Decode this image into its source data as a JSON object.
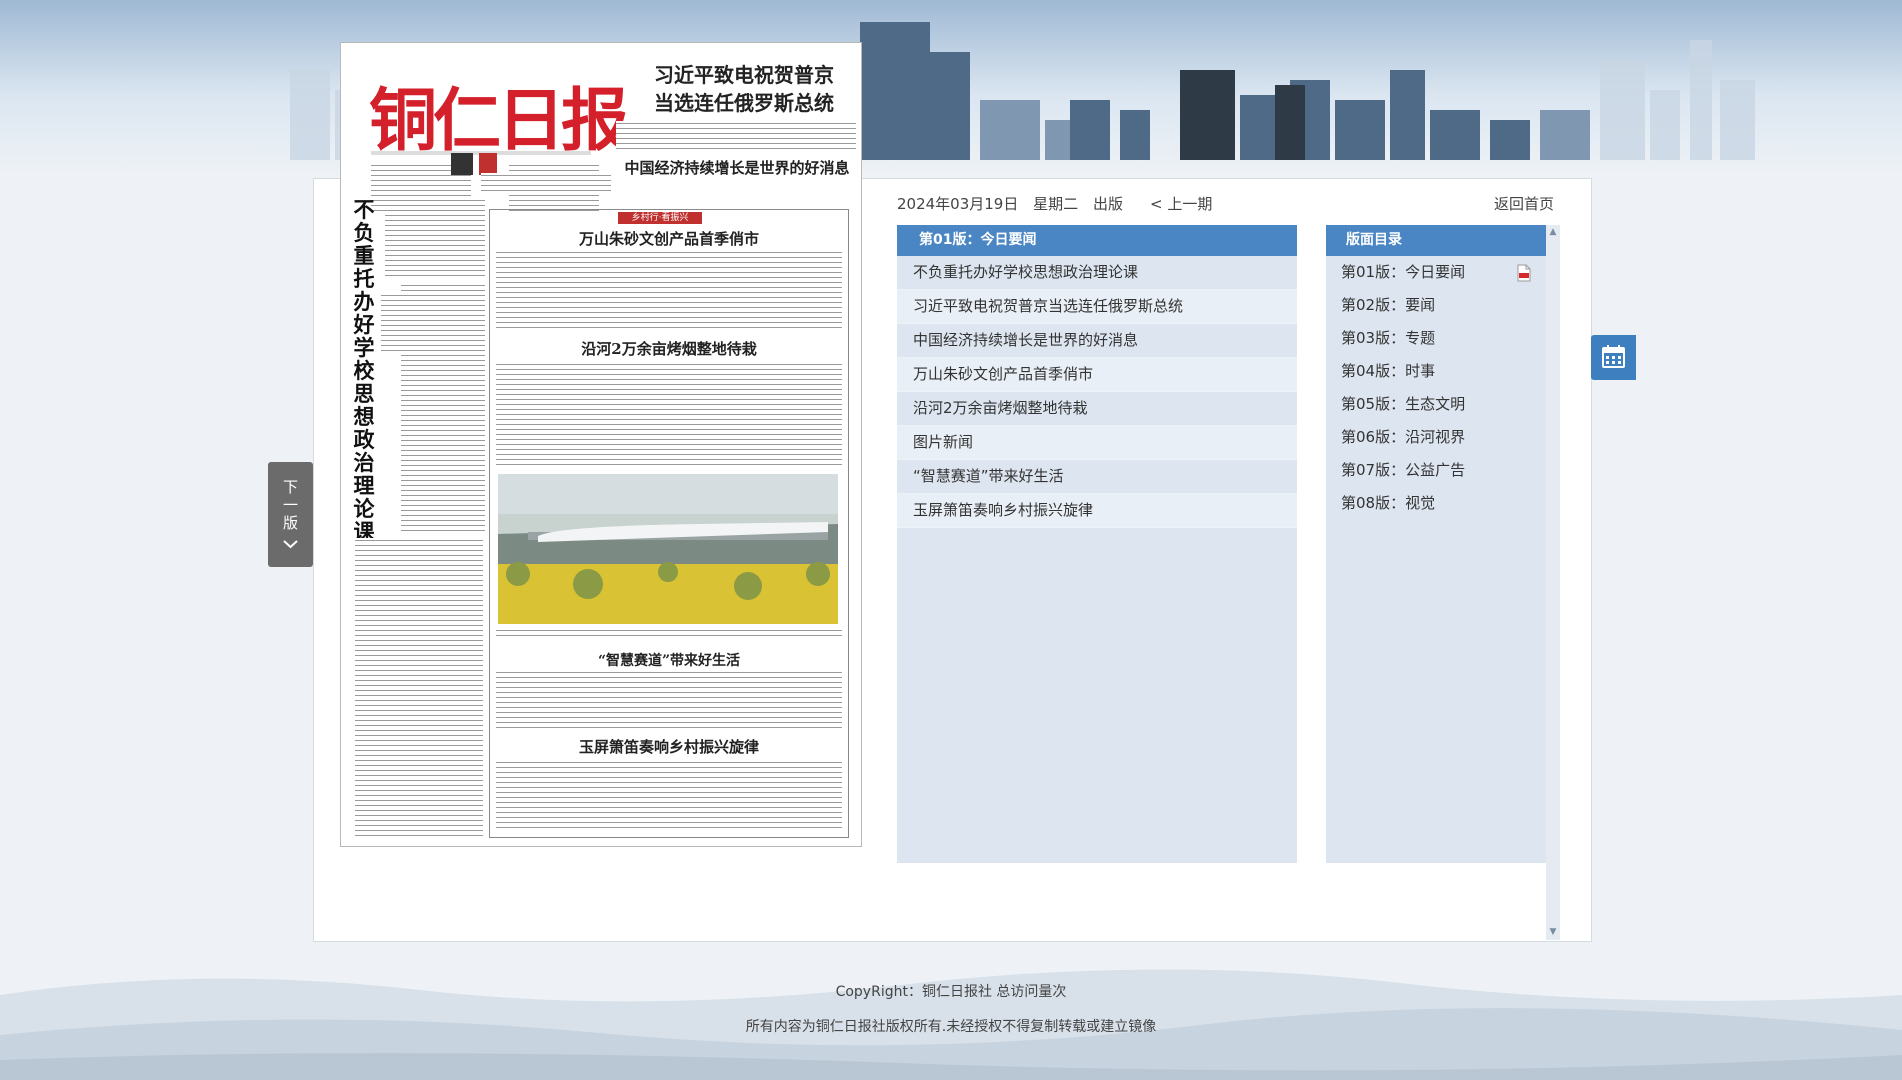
{
  "newspaper": {
    "masthead": "铜仁日报",
    "lead_headline_1": "习近平致电祝贺普京",
    "lead_headline_2": "当选连任俄罗斯总统",
    "second_headline": "中国经济持续增长是世界的好消息",
    "vertical_headline": "不负重托办好学校思想政治理论课",
    "column_tag": "乡村行·看振兴",
    "story1_headline": "万山朱砂文创产品首季俏市",
    "story2_headline": "沿河2万余亩烤烟整地待栽",
    "story3_headline": "“智慧赛道”带来好生活",
    "story4_headline": "玉屏箫笛奏响乡村振兴旋律"
  },
  "toolbar": {
    "date": "2024年03月19日",
    "weekday": "星期二",
    "published": "出版",
    "prev_issue": "< 上一期",
    "home": "返回首页"
  },
  "articles": {
    "header": "第01版：今日要闻",
    "items": [
      "不负重托办好学校思想政治理论课",
      "习近平致电祝贺普京当选连任俄罗斯总统",
      "中国经济持续增长是世界的好消息",
      "万山朱砂文创产品首季俏市",
      "沿河2万余亩烤烟整地待栽",
      "图片新闻",
      "“智慧赛道”带来好生活",
      "玉屏箫笛奏响乡村振兴旋律"
    ]
  },
  "pages": {
    "header": "版面目录",
    "items": [
      "第01版：今日要闻",
      "第02版：要闻",
      "第03版：专题",
      "第04版：时事",
      "第05版：生态文明",
      "第06版：沿河视界",
      "第07版：公益广告",
      "第08版：视觉"
    ]
  },
  "next_page": {
    "line1": "下",
    "line2": "一",
    "line3": "版"
  },
  "footer": {
    "copyright": "CopyRight：铜仁日报社  总访问量次",
    "notice": "所有内容为铜仁日报社版权所有.未经授权不得复制转载或建立镜像"
  },
  "colors": {
    "accent": "#4a86c4",
    "masthead": "#d3202a",
    "panel_bg": "#dde6f0"
  },
  "icons": [
    "calendar-icon",
    "pdf-icon",
    "chevron-down-icon",
    "scroll-up-icon",
    "scroll-down-icon"
  ]
}
